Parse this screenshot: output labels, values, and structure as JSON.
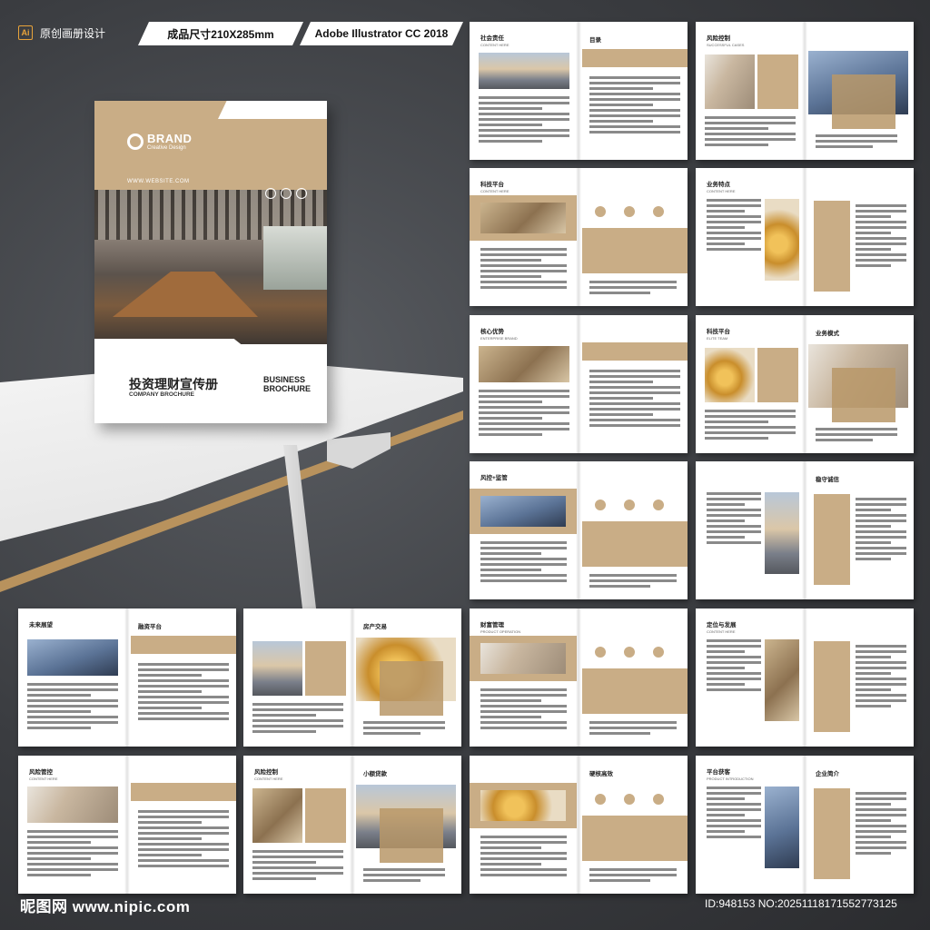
{
  "header": {
    "ai_badge": "Ai",
    "title": "原创画册设计",
    "size_label": "成品尺寸210X285mm",
    "software_label": "Adobe Illustrator CC 2018"
  },
  "cover": {
    "brand": "BRAND",
    "brand_sub": "Creative Design",
    "website": "WWW.WEBSITE.COM",
    "title_cn": "投资理财宣传册",
    "title_sub": "COMPANY BROCHURE",
    "title_en": "BUSINESS BROCHURE"
  },
  "spreads": [
    {
      "title": "社会责任",
      "sub": "CONTENT HERE",
      "right": "目录"
    },
    {
      "title": "风险控制",
      "sub": "SUCCESSFUL CASES",
      "right": ""
    },
    {
      "title": "科技平台",
      "sub": "CONTENT HERE",
      "right": ""
    },
    {
      "title": "业务特点",
      "sub": "CONTENT HERE",
      "right": ""
    },
    {
      "title": "核心优势",
      "sub": "ENTERPRISE BRAND",
      "right": ""
    },
    {
      "title": "科技平台",
      "sub": "ELITE TEAM",
      "right": "业务模式"
    },
    {
      "title": "风控+监管",
      "sub": "",
      "right": ""
    },
    {
      "title": "",
      "sub": "",
      "right": "稳守诚信"
    },
    {
      "title": "未来展望",
      "sub": "",
      "right": "融资平台"
    },
    {
      "title": "",
      "sub": "",
      "right": "房产交易"
    },
    {
      "title": "财富管理",
      "sub": "PRODUCT OPERATION",
      "right": ""
    },
    {
      "title": "定位与发展",
      "sub": "CONTENT HERE",
      "right": ""
    },
    {
      "title": "风险管控",
      "sub": "CONTENT HERE",
      "right": ""
    },
    {
      "title": "风险控制",
      "sub": "CONTENT HERE",
      "right": "小额贷款"
    },
    {
      "title": "",
      "sub": "",
      "right": "硬核高效"
    },
    {
      "title": "平台获客",
      "sub": "PRODUCT INTRODUCTION",
      "right": "企业简介"
    }
  ],
  "footer": {
    "site": "昵图网 www.nipic.com",
    "id": "ID:948153 NO:20251118171552773125"
  },
  "colors": {
    "accent": "#c9ad86",
    "background": "#3a3c40"
  }
}
